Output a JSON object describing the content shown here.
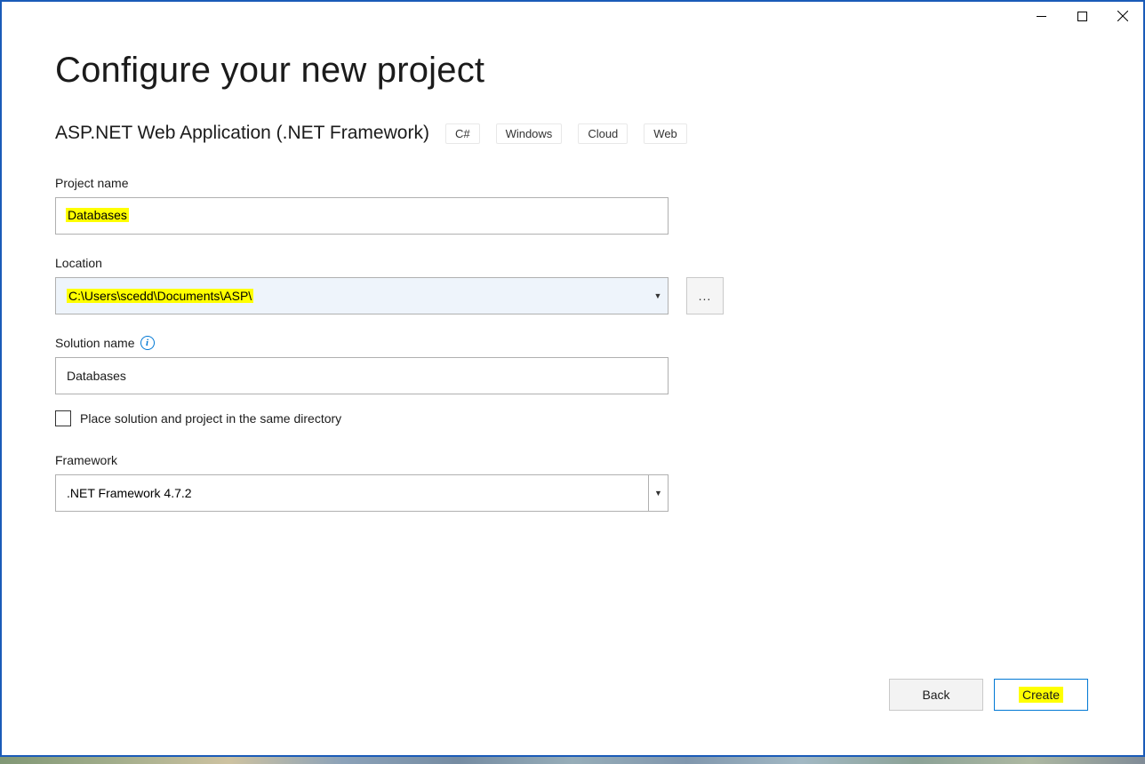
{
  "page_title": "Configure your new project",
  "subtitle": "ASP.NET Web Application (.NET Framework)",
  "tags": [
    "C#",
    "Windows",
    "Cloud",
    "Web"
  ],
  "labels": {
    "project_name": "Project name",
    "location": "Location",
    "solution_name": "Solution name",
    "framework": "Framework",
    "same_dir": "Place solution and project in the same directory"
  },
  "values": {
    "project_name": "Databases",
    "location": "C:\\Users\\scedd\\Documents\\ASP\\",
    "solution_name": "Databases",
    "framework": ".NET Framework 4.7.2",
    "same_dir_checked": false
  },
  "buttons": {
    "back": "Back",
    "create": "Create",
    "browse": "..."
  },
  "colors": {
    "accent": "#0078d4",
    "highlight": "#ffff00"
  }
}
